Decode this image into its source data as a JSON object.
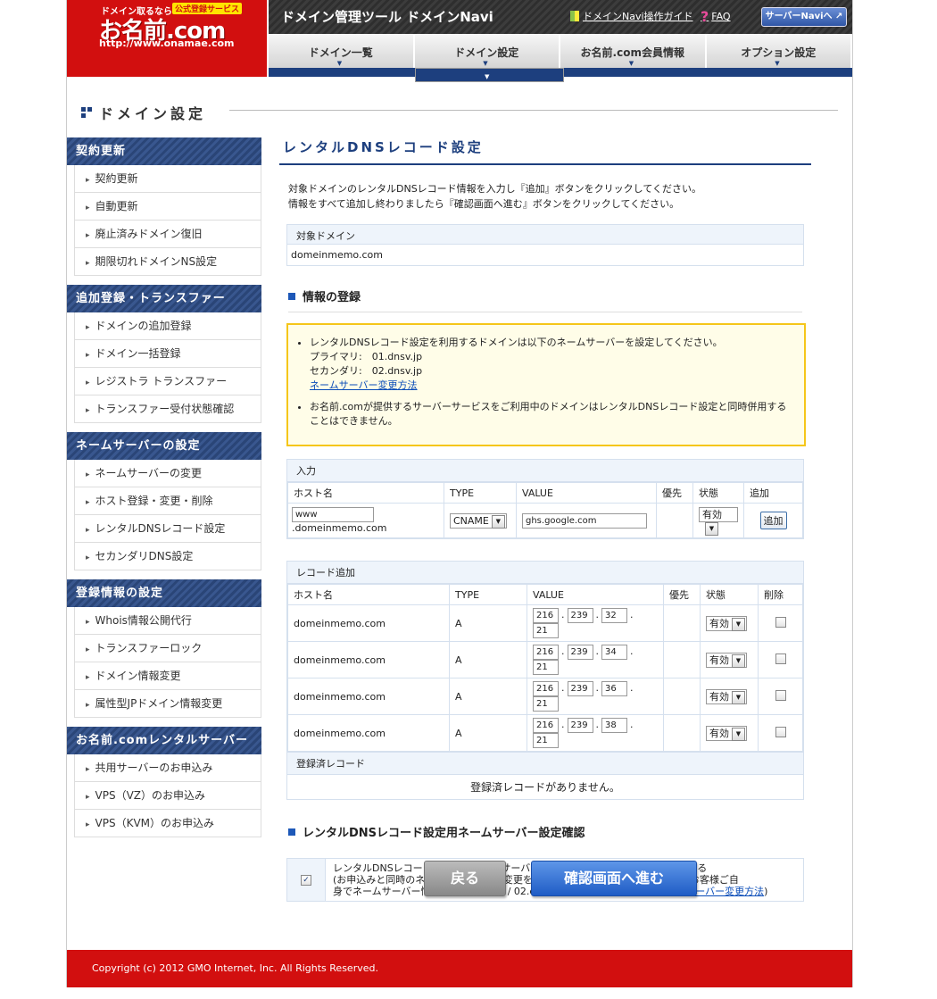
{
  "logo": {
    "tagline": "ドメイン取るなら",
    "badge": "公式登録サービス",
    "brand": "お名前.com",
    "url": "http://www.onamae.com"
  },
  "header": {
    "title": "ドメイン管理ツール ドメインNavi",
    "guide_link": "ドメインNavi操作ガイド",
    "faq_link": "FAQ",
    "server_navi_button": "サーバーNaviへ ↗"
  },
  "nav": {
    "tabs": [
      "ドメイン一覧",
      "ドメイン設定",
      "お名前.com会員情報",
      "オプション設定"
    ],
    "selected": "ドメイン設定"
  },
  "page_title": "ドメイン設定",
  "sidebar": [
    {
      "title": "契約更新",
      "items": [
        "契約更新",
        "自動更新",
        "廃止済みドメイン復旧",
        "期限切れドメインNS設定"
      ]
    },
    {
      "title": "追加登録・トランスファー",
      "items": [
        "ドメインの追加登録",
        "ドメイン一括登録",
        "レジストラ トランスファー",
        "トランスファー受付状態確認"
      ]
    },
    {
      "title": "ネームサーバーの設定",
      "items": [
        "ネームサーバーの変更",
        "ホスト登録・変更・削除",
        "レンタルDNSレコード設定",
        "セカンダリDNS設定"
      ]
    },
    {
      "title": "登録情報の設定",
      "items": [
        "Whois情報公開代行",
        "トランスファーロック",
        "ドメイン情報変更",
        "属性型JPドメイン情報変更"
      ]
    },
    {
      "title": "お名前.comレンタルサーバー",
      "items": [
        "共用サーバーのお申込み",
        "VPS（VZ）のお申込み",
        "VPS（KVM）のお申込み"
      ]
    }
  ],
  "main": {
    "title": "レンタルDNSレコード設定",
    "intro1": "対象ドメインのレンタルDNSレコード情報を入力し『追加』ボタンをクリックしてください。",
    "intro2": "情報をすべて追加し終わりましたら『確認画面へ進む』ボタンをクリックしてください。",
    "target_label": "対象ドメイン",
    "target_value": "domeinmemo.com",
    "section_register": "情報の登録",
    "notice": {
      "line1": "レンタルDNSレコード設定を利用するドメインは以下のネームサーバーを設定してください。",
      "primary": "プライマリ:　01.dnsv.jp",
      "secondary": "セカンダリ:　02.dnsv.jp",
      "link": "ネームサーバー変更方法",
      "line2": "お名前.comが提供するサーバーサービスをご利用中のドメインはレンタルDNSレコード設定と同時併用することはできません。"
    },
    "input_table": {
      "caption": "入力",
      "headers": [
        "ホスト名",
        "TYPE",
        "VALUE",
        "優先",
        "状態",
        "追加"
      ],
      "host_value": "www",
      "host_suffix": ".domeinmemo.com",
      "type_value": "CNAME",
      "value_value": "ghs.google.com",
      "status_value": "有効",
      "add_button": "追加"
    },
    "records_table": {
      "caption": "レコード追加",
      "headers": [
        "ホスト名",
        "TYPE",
        "VALUE",
        "優先",
        "状態",
        "削除"
      ],
      "rows": [
        {
          "host": "domeinmemo.com",
          "type": "A",
          "ip": [
            "216",
            "239",
            "32",
            "21"
          ],
          "status": "有効"
        },
        {
          "host": "domeinmemo.com",
          "type": "A",
          "ip": [
            "216",
            "239",
            "34",
            "21"
          ],
          "status": "有効"
        },
        {
          "host": "domeinmemo.com",
          "type": "A",
          "ip": [
            "216",
            "239",
            "36",
            "21"
          ],
          "status": "有効"
        },
        {
          "host": "domeinmemo.com",
          "type": "A",
          "ip": [
            "216",
            "239",
            "38",
            "21"
          ],
          "status": "有効"
        }
      ],
      "registered_caption": "登録済レコード",
      "registered_empty": "登録済レコードがありません。"
    },
    "section_ns": "レンタルDNSレコード設定用ネームサーバー設定確認",
    "ns_confirm": {
      "line1": "レンタルDNSレコード設定用のネームサーバー(01.dnsv.jp / 02.dnsv.jp)に変更する",
      "line2": "(お申込みと同時のネームサーバー情報変更を希望されない場合は、お申込み後にお客様ご自",
      "line3": "身でネームサーバー情報を(01.dnsv.jp / 02.dnsv.jp)へご変更ください。",
      "link": "ネームサーバー変更方法",
      "close": ")"
    },
    "back_button": "戻る",
    "confirm_button": "確認画面へ進む"
  },
  "footer": "Copyright (c) 2012 GMO Internet, Inc. All Rights Reserved."
}
